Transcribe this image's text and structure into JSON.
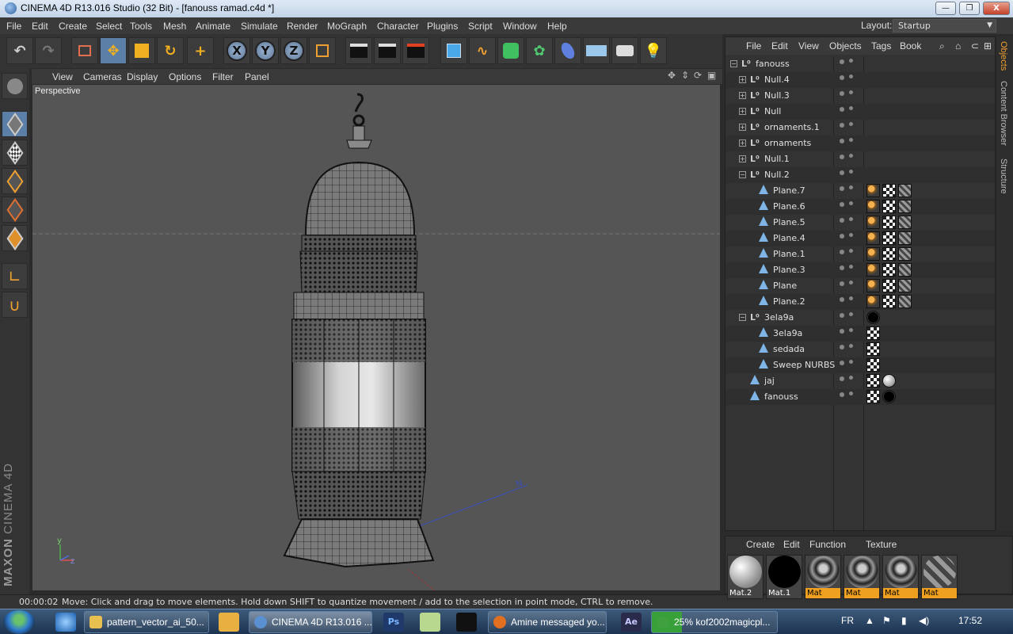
{
  "window": {
    "title": "CINEMA 4D R13.016 Studio (32 Bit) - [fanouss ramad.c4d *]",
    "min_label": "—",
    "max_label": "❐",
    "close_label": "X"
  },
  "menubar": {
    "items": [
      "File",
      "Edit",
      "Create",
      "Select",
      "Tools",
      "Mesh",
      "Animate",
      "Simulate",
      "Render",
      "MoGraph",
      "Character",
      "Plugins",
      "Script",
      "Window",
      "Help"
    ],
    "layout_label": "Layout:",
    "layout_value": "Startup"
  },
  "toolbar": {
    "axis_x": "X",
    "axis_y": "Y",
    "axis_z": "Z"
  },
  "viewport": {
    "menu": [
      "View",
      "Cameras",
      "Display",
      "Options",
      "Filter",
      "Panel"
    ],
    "camera_label": "Perspective",
    "axis_y_label": "y",
    "axis_z_label": "z",
    "axis_n_label": "N"
  },
  "branding": {
    "maxon": "MAXON",
    "product": "CINEMA 4D"
  },
  "status": {
    "time": "00:00:02",
    "message": "Move: Click and drag to move elements. Hold down SHIFT to quantize movement / add to the selection in point mode, CTRL to remove."
  },
  "object_manager": {
    "menu": [
      "File",
      "Edit",
      "View",
      "Objects",
      "Tags",
      "Book"
    ],
    "objects": [
      {
        "name": "fanouss",
        "type": "null",
        "level": 0,
        "expanded": true,
        "tags": []
      },
      {
        "name": "Null.4",
        "type": "null",
        "level": 1,
        "expanded": false,
        "tags": []
      },
      {
        "name": "Null.3",
        "type": "null",
        "level": 1,
        "expanded": false,
        "tags": []
      },
      {
        "name": "Null",
        "type": "null",
        "level": 1,
        "expanded": false,
        "tags": []
      },
      {
        "name": "ornaments.1",
        "type": "null",
        "level": 1,
        "expanded": false,
        "tags": []
      },
      {
        "name": "ornaments",
        "type": "null",
        "level": 1,
        "expanded": false,
        "tags": []
      },
      {
        "name": "Null.1",
        "type": "null",
        "level": 1,
        "expanded": false,
        "tags": []
      },
      {
        "name": "Null.2",
        "type": "null",
        "level": 1,
        "expanded": true,
        "tags": []
      },
      {
        "name": "Plane.7",
        "type": "poly",
        "level": 2,
        "tags": [
          "phong",
          "tex",
          "pat"
        ]
      },
      {
        "name": "Plane.6",
        "type": "poly",
        "level": 2,
        "tags": [
          "phong",
          "tex",
          "pat"
        ]
      },
      {
        "name": "Plane.5",
        "type": "poly",
        "level": 2,
        "tags": [
          "phong",
          "tex",
          "pat"
        ]
      },
      {
        "name": "Plane.4",
        "type": "poly",
        "level": 2,
        "tags": [
          "phong",
          "tex",
          "pat"
        ]
      },
      {
        "name": "Plane.1",
        "type": "poly",
        "level": 2,
        "tags": [
          "phong",
          "tex",
          "pat"
        ]
      },
      {
        "name": "Plane.3",
        "type": "poly",
        "level": 2,
        "tags": [
          "phong",
          "tex",
          "pat"
        ]
      },
      {
        "name": "Plane",
        "type": "poly",
        "level": 2,
        "tags": [
          "phong",
          "tex",
          "pat"
        ]
      },
      {
        "name": "Plane.2",
        "type": "poly",
        "level": 2,
        "tags": [
          "phong",
          "tex",
          "pat"
        ]
      },
      {
        "name": "3ela9a",
        "type": "null",
        "level": 1,
        "expanded": true,
        "tags": [
          "black"
        ]
      },
      {
        "name": "3ela9a",
        "type": "poly",
        "level": 2,
        "tags": [
          "tex"
        ]
      },
      {
        "name": "sedada",
        "type": "poly",
        "level": 2,
        "tags": [
          "tex"
        ]
      },
      {
        "name": "Sweep NURBS",
        "type": "poly",
        "level": 2,
        "tags": [
          "tex"
        ]
      },
      {
        "name": "jaj",
        "type": "poly",
        "level": 1,
        "tags": [
          "tex",
          "white"
        ]
      },
      {
        "name": "fanouss",
        "type": "poly",
        "level": 1,
        "tags": [
          "tex",
          "black"
        ]
      }
    ]
  },
  "side_tabs": [
    "Objects",
    "Content Browser",
    "Structure"
  ],
  "material_manager": {
    "menu": [
      "Create",
      "Edit",
      "Function",
      "Texture"
    ],
    "materials": [
      {
        "name": "Mat.2",
        "swatch": "white",
        "highlight": false
      },
      {
        "name": "Mat.1",
        "swatch": "black",
        "highlight": false
      },
      {
        "name": "Mat",
        "swatch": "pattern",
        "highlight": true
      },
      {
        "name": "Mat",
        "swatch": "pattern",
        "highlight": true
      },
      {
        "name": "Mat",
        "swatch": "pattern",
        "highlight": true
      },
      {
        "name": "Mat",
        "swatch": "stripes",
        "highlight": true
      }
    ]
  },
  "taskbar": {
    "tasks": [
      {
        "label": "pattern_vector_ai_50...",
        "color": "#e8c050"
      },
      {
        "label": "CINEMA 4D R13.016 ...",
        "color": "#5a8fd0",
        "active": true
      },
      {
        "label": "Amine messaged yo...",
        "color": "#e07020"
      },
      {
        "label": "25% kof2002magicpl...",
        "color": "#40a040"
      }
    ],
    "quick_ps": "Ps",
    "quick_ae": "Ae",
    "language": "FR",
    "clock": "17:52"
  }
}
